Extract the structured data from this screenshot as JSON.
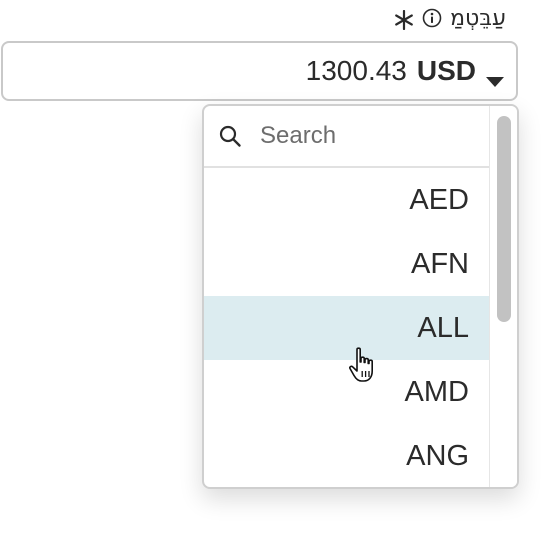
{
  "field_label": {
    "required_mark": "*",
    "info_icon": "info-circle-icon",
    "text": "עַבֵּטְמַ"
  },
  "amount_field": {
    "amount": "1300.43",
    "currency": "USD",
    "caret_icon": "caret-down-icon"
  },
  "dropdown": {
    "search_icon": "search-icon",
    "search_placeholder": "Search",
    "options": [
      {
        "label": "AED",
        "hovered": false
      },
      {
        "label": "AFN",
        "hovered": false
      },
      {
        "label": "ALL",
        "hovered": true
      },
      {
        "label": "AMD",
        "hovered": false
      },
      {
        "label": "ANG",
        "hovered": false
      }
    ]
  },
  "cursor_icon": "hand-pointer-icon"
}
